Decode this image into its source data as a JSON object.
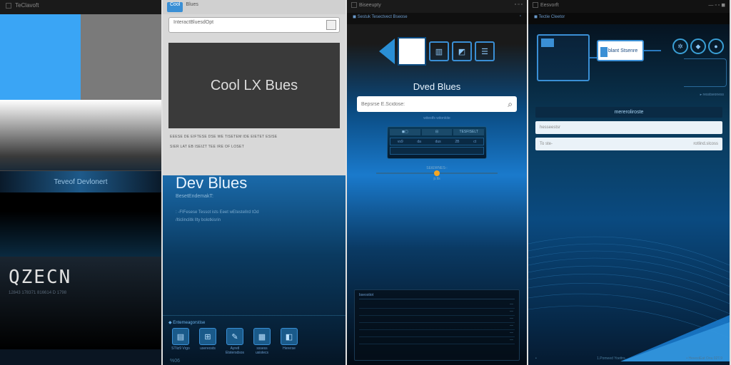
{
  "panel1": {
    "app_label": "TeClavoft",
    "stripe_text": "Teveof Devlonert",
    "logo_text": "QZECN",
    "logo_footer": "12843 178371\n816614 D 1798"
  },
  "panel2": {
    "chip": "Cool",
    "tab2": "Blues",
    "addr": "InteractBluesdOpt",
    "hero": "Cool LX Bues",
    "micro1": "EEESE DE EIFTESE DSE WE TISETEM IDE EIETET ESISE",
    "micro2": "SIER LAT EB ISEIZT TEE IRE OF LOSET",
    "dev_title": "Dev Blues",
    "dev_sub": "BesetEndemakT:",
    "dev_line1": ": -FIFesese Tessot ists Eeet wEtestelIrd tOd",
    "dev_line2": "/lticlinclitk llty bolotkisrin",
    "iconbar_caption": "◆ Entemeagorstise",
    "icons": [
      {
        "glyph": "▤",
        "label": "STliz9 Vrgo"
      },
      {
        "glyph": "⊞",
        "label": "usereosts"
      },
      {
        "glyph": "✎",
        "label": "Ayretl Etstersdsos"
      },
      {
        "glyph": "▦",
        "label": "sssess usistecs"
      },
      {
        "glyph": "◧",
        "label": "Hererse"
      }
    ],
    "pct": "%06"
  },
  "panel3": {
    "app_label": "Biseeupty",
    "crumb": "◼ Sestuk Tesectvect Bseose",
    "section_title": "Dved Blues",
    "search_placeholder": "Bepsrse E.Scidose:",
    "search_hint": "witestfs witonkite",
    "widget_tabs": [
      "◼▢",
      "⊟",
      "TESFISELT"
    ],
    "widget_cells": [
      "vs9",
      "da",
      "dus",
      "2B",
      "ct"
    ],
    "stepper_label": "SEtEWNES-:",
    "stepper_sub": "p.lts",
    "list_header": "bseostiot",
    "list_rows": [
      "",
      "",
      "",
      "",
      "",
      ""
    ]
  },
  "panel4": {
    "app_label": "Eesvorft",
    "sub": "◼ Tectie Cleetor",
    "box_label": "blant Stsenre",
    "section_head": "mereroliroste",
    "field1_placeholder": "hesseestsr",
    "field2_left": "To ste-",
    "field2_right": "rotlind.slcoss",
    "foot_a": "•",
    "foot_b": "1.Pomeed Yoettrs.",
    "foot_c": "• HevestEat Onu 02T.9"
  }
}
